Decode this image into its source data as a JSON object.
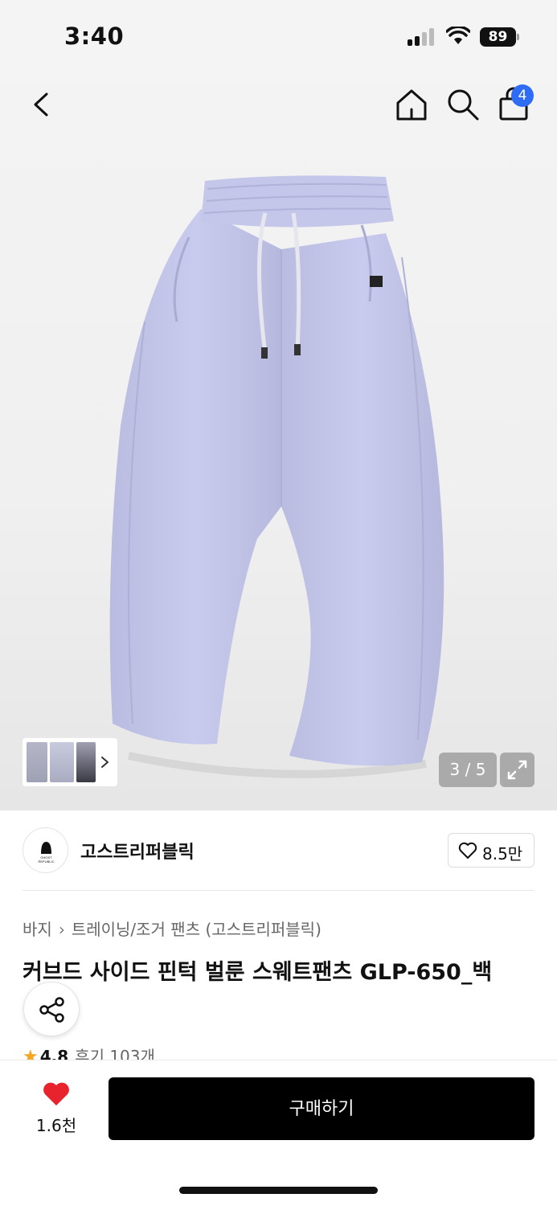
{
  "status_bar": {
    "time": "3:40",
    "battery": "89"
  },
  "nav": {
    "cart_badge": "4",
    "icons": [
      "chevron-left-icon",
      "home-icon",
      "search-icon",
      "shopping-bag-icon"
    ]
  },
  "gallery": {
    "counter": "3 / 5",
    "icons": [
      "chevron-right-icon",
      "expand-icon"
    ]
  },
  "brand": {
    "name": "고스트리퍼블릭",
    "logo_text": "GHOST REPUBLIC",
    "like_count": "8.5만"
  },
  "breadcrumb": {
    "items": [
      "바지",
      "트레이닝/조거 팬츠 (고스트리퍼블릭)"
    ]
  },
  "product": {
    "title": "커브드 사이드 핀턱 벌룬 스웨트팬츠 GLP-650_백",
    "rating": "4.8",
    "reviews": "후기 103개"
  },
  "bottom": {
    "wish_count": "1.6천",
    "buy_label": "구매하기"
  },
  "colors": {
    "badge": "#2f6cf6",
    "star": "#f5a623",
    "heart": "#e8232d",
    "buy_button": "#000000"
  }
}
